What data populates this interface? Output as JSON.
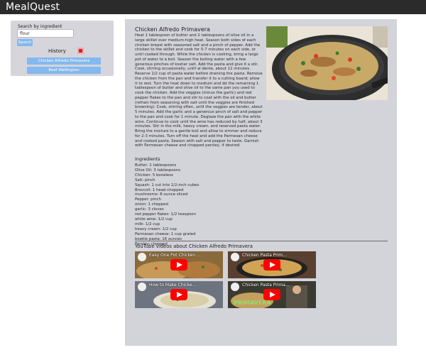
{
  "app": {
    "title": "MealQuest"
  },
  "search": {
    "label": "Search by ingredient",
    "value": "flour",
    "button_label": "Search"
  },
  "history": {
    "label": "History",
    "items": [
      "Chicken Alfredo Primavera",
      "Beef Wellington"
    ]
  },
  "recipe": {
    "title": "Chicken Alfredo Primavera",
    "instructions": "Heat 1 tablespoon of butter and 2 tablespoons of olive oil in a large skillet over medium-high heat. Season both sides of each chicken breast with seasoned salt and a pinch of pepper. Add the chicken to the skillet and cook for 5-7 minutes on each side, or until cooked through. While the chicken is cooking, bring a large pot of water to a boil. Season the boiling water with a few generous pinches of kosher salt. Add the pasta and give it a stir. Cook, stirring occasionally, until al dente, about 12 minutes. Reserve 1/2 cup of pasta water before draining the pasta. Remove the chicken from the pan and transfer it to a cutting board; allow it to rest. Turn the heat down to medium and dd the remaining 1 tablespoon of butter and olive oil to the same pan you used to cook the chicken. Add the veggies (minus the garlic) and red pepper flakes to the pan and stir to coat with the oil and butter (refrain from seasoning with salt until the veggies are finished browning). Cook, stirring often, until the veggies are tender, about 5 minutes. Add the garlic and a generous pinch of salt and pepper to the pan and cook for 1 minute. Deglaze the pan with the white wine. Continue to cook until the wine has reduced by half, about 3 minutes. Stir in the milk, heavy cream, and reserved pasta water. Bring the mixture to a gentle boil and allow to simmer and reduce for 2-3 minutes. Turn off the heat and add the Parmesan cheese and cooked pasta. Season with salt and pepper to taste. Garnish with Parmesan cheese and chopped parsley, if desired.",
    "ingredients_title": "Ingredients",
    "ingredients": [
      "Butter: 2 tablespoons",
      "Olive Oil: 3 tablespoons",
      "Chicken: 5 boneless",
      "Salt: pinch",
      "Squash: 1 cut into 1/2-inch cubes",
      "Broccoli: 1 head chopped",
      "mushrooms: 8-ounce sliced",
      "Pepper: pinch",
      "onion: 1 chopped",
      "garlic: 3 cloves",
      "red pepper flakes: 1/2 teaspoon",
      "white wine: 1/2 cup",
      "milk: 1/2 cup",
      "heavy cream: 1/2 cup",
      "Parmesan cheese: 1 cup grated",
      "bowtie pasta: 16 ounces",
      "Parsley: chopped"
    ]
  },
  "videos": {
    "heading": "YouTube videos about Chicken Alfredo Primavera",
    "items": [
      {
        "caption": "Easy One Pot Chicken ...",
        "bg": "#8a6a3c"
      },
      {
        "caption": "Chicken Pasta Prim...",
        "bg": "#5a4030"
      },
      {
        "caption": "How to Make Chicke...",
        "bg": "#6d7480"
      },
      {
        "caption": "Chicken Pasta Prima...",
        "bg": "#3a3a30",
        "overlay_text": "PRIMAVERA"
      }
    ]
  },
  "colors": {
    "accent": "#84b8ee",
    "topbar": "#2b2b2b",
    "panel": "#d3d3da",
    "youtube": "#ff0000"
  }
}
